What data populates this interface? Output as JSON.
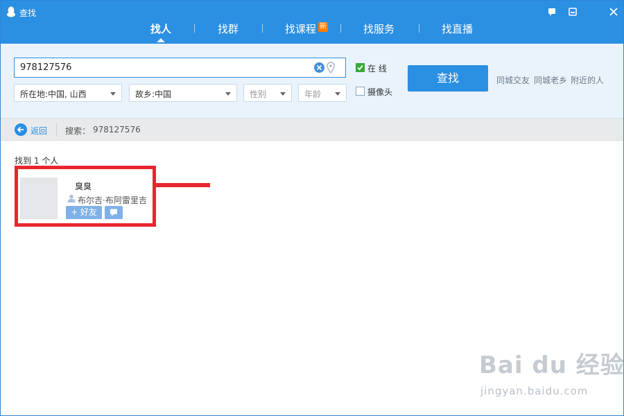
{
  "window": {
    "title": "查找"
  },
  "nav": {
    "tabs": [
      {
        "label": "找人",
        "active": true
      },
      {
        "label": "找群",
        "active": false
      },
      {
        "label": "找课程",
        "active": false,
        "badge": "新"
      },
      {
        "label": "找服务",
        "active": false
      },
      {
        "label": "找直播",
        "active": false
      }
    ]
  },
  "search": {
    "value": "978127576",
    "online_label": "在 线",
    "online_checked": true,
    "camera_label": "摄像头",
    "camera_checked": false,
    "button_label": "查找",
    "filters": {
      "location": "所在地:中国, 山西",
      "hometown": "故乡:中国",
      "gender": "性别",
      "age": "年龄"
    },
    "quick_links": [
      "同城交友",
      "同城老乡",
      "附近的人"
    ]
  },
  "breadcrumb": {
    "back_label": "返回",
    "search_label": "搜索：",
    "search_value": "978127576"
  },
  "results": {
    "count_text": "找到 1 个人",
    "items": [
      {
        "nickname": "臭臭",
        "location": "布尔吉·布阿雷里吉",
        "add_label": "+ 好友"
      }
    ]
  },
  "watermark": {
    "main": "Bai du 经验",
    "sub": "jingyan.baidu.com"
  },
  "colors": {
    "primary": "#2b8fe2",
    "highlight": "#e8262e",
    "panel": "#eaf3fc",
    "badge": "#ff7a00"
  }
}
